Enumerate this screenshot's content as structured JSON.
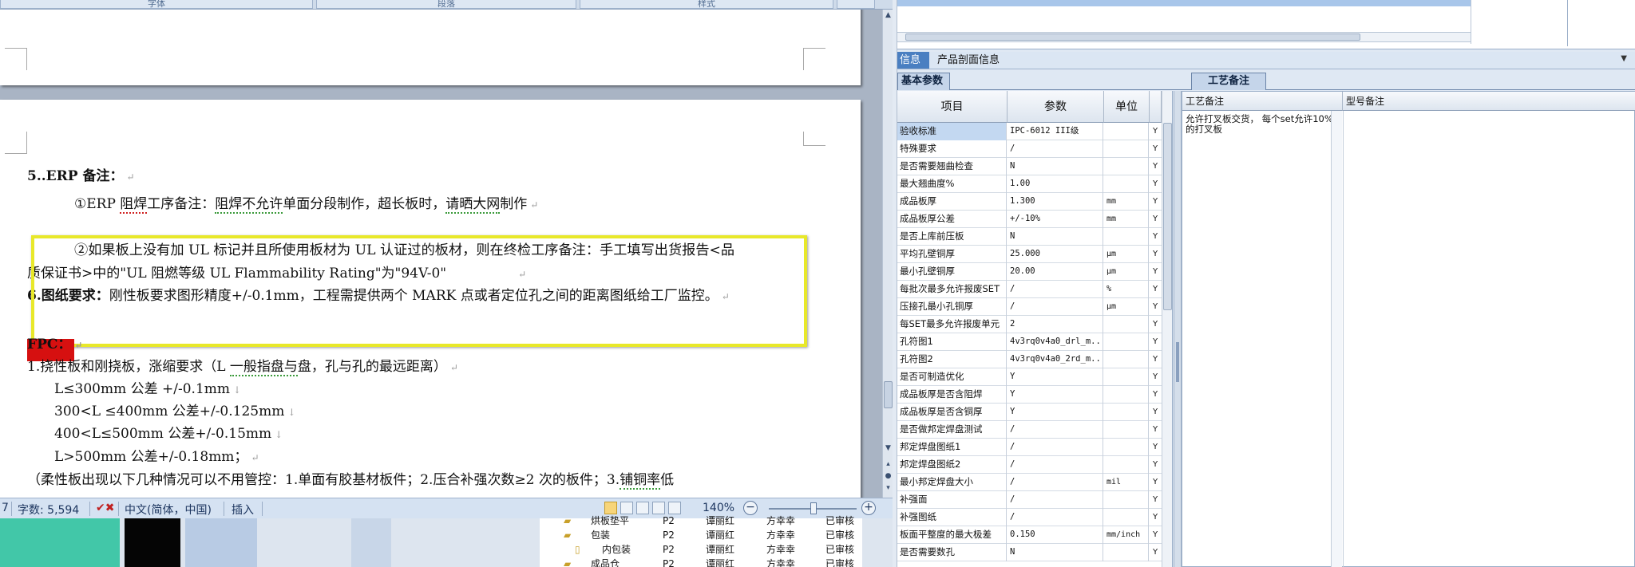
{
  "word": {
    "top_tabs": [
      "字体",
      "段落",
      "样式"
    ],
    "lines": {
      "l1": "5..ERP 备注：",
      "l2a": "①ERP ",
      "l2b": "阻焊",
      "l2c": "工序备注：",
      "l2d": "阻焊不允许",
      "l2e": "单面分段制作，超长板时，",
      "l2f": "请晒大网",
      "l2g": "制作",
      "l3": "②如果板上没有加 UL 标记并且所使用板材为 UL 认证过的板材，则在终检工序备注：手工填写出货报告<品",
      "l4": "质保证书>中的\"UL 阻燃等级 UL Flammability Rating\"为\"94V-0\"",
      "l5a": "6.图纸要求：",
      "l5b": "刚性板要求图形精度+/-0.1mm，工程需提供两个 MARK 点或者定位孔之间的距离图纸给工厂监控。",
      "l6": "FPC：",
      "l7a": "1.挠性板和刚挠板，涨缩要求（L ",
      "l7b": "一般指盘与",
      "l7c": "盘，孔与孔的最远距离）",
      "l8": "L≤300mm 公差 +/-0.1mm",
      "l9": "300<L ≤400mm 公差+/-0.125mm",
      "l10": "400<L≤500mm 公差+/-0.15mm",
      "l11": "L>500mm 公差+/-0.18mm；",
      "l12a": "（柔性板出现以下几种情况可以不用管控：1.单面有胶基材板件；2.压合补强次数≥2 次的板件；3.",
      "l12b": "铺铜率",
      "l12c": "低"
    },
    "status": {
      "page": "7",
      "word_count": "字数: 5,594",
      "language": "中文(简体，中国)",
      "mode": "插入",
      "zoom": "140%"
    }
  },
  "bg_tree": [
    {
      "name": "烘板垫平",
      "code": "P2",
      "person": "谭丽红",
      "approver": "方幸幸",
      "status": "已审核"
    },
    {
      "name": "包装",
      "code": "P2",
      "person": "谭丽红",
      "approver": "方幸幸",
      "status": "已审核"
    },
    {
      "name": "内包装",
      "code": "P2",
      "person": "谭丽红",
      "approver": "方幸幸",
      "status": "已审核"
    },
    {
      "name": "成品仓",
      "code": "P2",
      "person": "谭丽红",
      "approver": "方幸幸",
      "status": "已审核"
    }
  ],
  "erp": {
    "info_tab": "信息",
    "product_tab": "产品剖面信息",
    "basic_tab": "基本参数",
    "process_tab": "工艺备注",
    "grid_headers": [
      "项目",
      "参数",
      "单位"
    ],
    "notes_headers": [
      "工艺备注",
      "型号备注"
    ],
    "note_text": "允许打叉板交货， 每个set允许10%的打叉板",
    "rows": [
      {
        "item": "验收标准",
        "value": "IPC-6012 III级",
        "unit": "",
        "flag": "Y"
      },
      {
        "item": "特殊要求",
        "value": "/",
        "unit": "",
        "flag": "Y"
      },
      {
        "item": "是否需要翘曲检查",
        "value": "N",
        "unit": "",
        "flag": "Y"
      },
      {
        "item": "最大翘曲度%",
        "value": "1.00",
        "unit": "",
        "flag": "Y"
      },
      {
        "item": "成品板厚",
        "value": "1.300",
        "unit": "mm",
        "flag": "Y"
      },
      {
        "item": "成品板厚公差",
        "value": "+/-10%",
        "unit": "mm",
        "flag": "Y"
      },
      {
        "item": "是否上库前压板",
        "value": "N",
        "unit": "",
        "flag": "Y"
      },
      {
        "item": "平均孔壁铜厚",
        "value": "25.000",
        "unit": "μm",
        "flag": "Y"
      },
      {
        "item": "最小孔壁铜厚",
        "value": "20.00",
        "unit": "μm",
        "flag": "Y"
      },
      {
        "item": "每批次最多允许报废SET",
        "value": "/",
        "unit": "%",
        "flag": "Y"
      },
      {
        "item": "压接孔最小孔铜厚",
        "value": "/",
        "unit": "μm",
        "flag": "Y"
      },
      {
        "item": "每SET最多允许报废单元",
        "value": "2",
        "unit": "",
        "flag": "Y"
      },
      {
        "item": "孔符图1",
        "value": "4v3rq0v4a0_drl_m...",
        "unit": "",
        "flag": "Y"
      },
      {
        "item": "孔符图2",
        "value": "4v3rq0v4a0_2rd_m...",
        "unit": "",
        "flag": "Y"
      },
      {
        "item": "是否可制造优化",
        "value": "Y",
        "unit": "",
        "flag": "Y"
      },
      {
        "item": "成品板厚是否含阻焊",
        "value": "Y",
        "unit": "",
        "flag": "Y"
      },
      {
        "item": "成品板厚是否含铜厚",
        "value": "Y",
        "unit": "",
        "flag": "Y"
      },
      {
        "item": "是否做邦定焊盘测试",
        "value": "/",
        "unit": "",
        "flag": "Y"
      },
      {
        "item": "邦定焊盘图纸1",
        "value": "/",
        "unit": "",
        "flag": "Y"
      },
      {
        "item": "邦定焊盘图纸2",
        "value": "/",
        "unit": "",
        "flag": "Y"
      },
      {
        "item": "最小邦定焊盘大小",
        "value": "/",
        "unit": "mil",
        "flag": "Y"
      },
      {
        "item": "补强面",
        "value": "/",
        "unit": "",
        "flag": "Y"
      },
      {
        "item": "补强图纸",
        "value": "/",
        "unit": "",
        "flag": "Y"
      },
      {
        "item": "板面平整度的最大极差",
        "value": "0.150",
        "unit": "mm/inch",
        "flag": "Y"
      },
      {
        "item": "是否需要数孔",
        "value": "N",
        "unit": "",
        "flag": "Y"
      }
    ]
  },
  "colors": {
    "highlight": "#e8e82a",
    "redbox": "#d61010",
    "accent": "#4a7fc1",
    "teal": "#42c7a8"
  }
}
